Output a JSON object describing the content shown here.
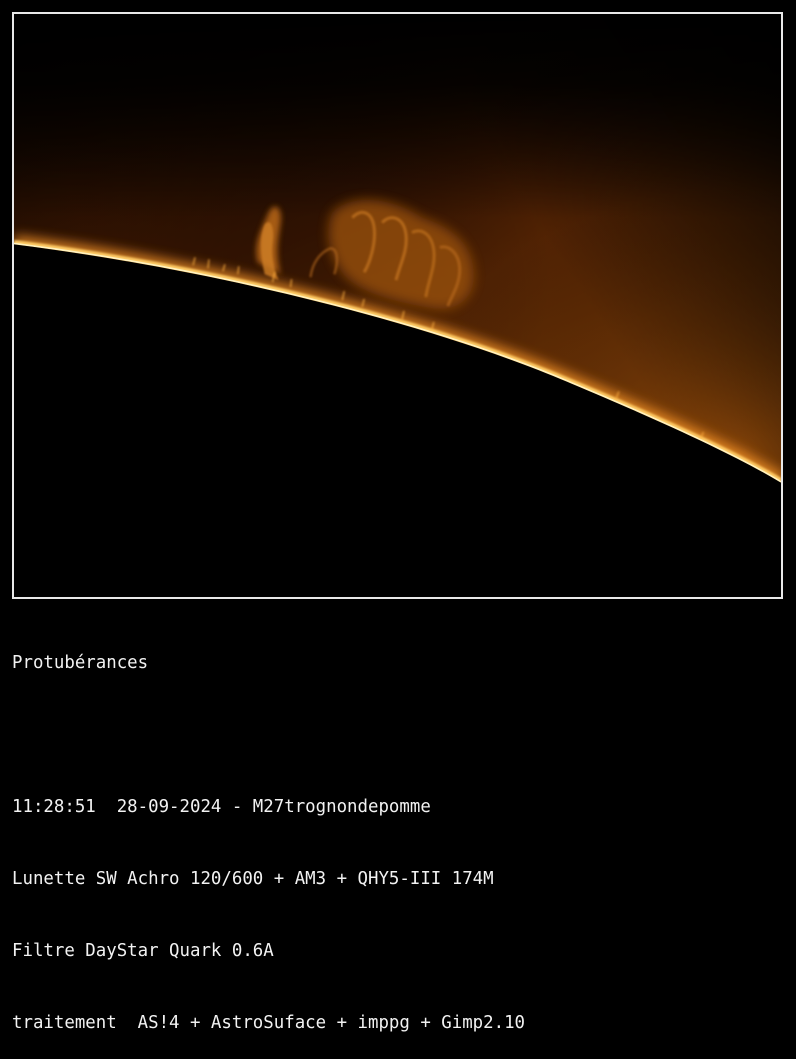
{
  "image": {
    "subject": "solar-limb-prominences"
  },
  "caption": {
    "title": "Protubérances",
    "line_time": "11:28:51  28-09-2024 - M27trognondepomme",
    "line_scope": "Lunette SW Achro 120/600 + AM3 + QHY5-III 174M",
    "line_filter": "Filtre DayStar Quark 0.6A",
    "line_processing": "traitement  AS!4 + AstroSuface + imppg + Gimp2.10"
  }
}
